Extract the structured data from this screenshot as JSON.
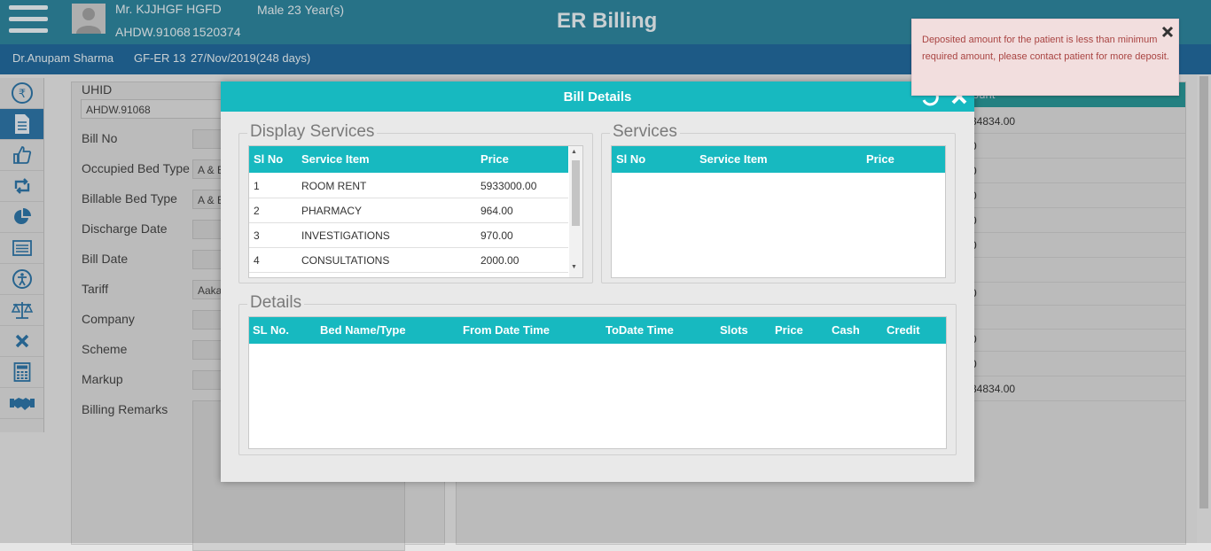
{
  "patient": {
    "name": "Mr. KJJHGF HGFD",
    "gender_age": "Male 23 Year(s)",
    "uhid": "AHDW.91068",
    "id": "1520374"
  },
  "app_title": "ER Billing",
  "subbar": {
    "doctor": "Dr.Anupam Sharma",
    "ward": "GF-ER 13",
    "admission": "27/Nov/2019(248 days)"
  },
  "sidebar": {
    "items": [
      "rupee-icon",
      "document-icon",
      "thumbs-up-icon",
      "retweet-icon",
      "pie-chart-icon",
      "list-icon",
      "accessibility-icon",
      "scale-icon",
      "close-icon",
      "calculator-icon",
      "handshake-icon"
    ]
  },
  "form": {
    "uhid_label": "UHID",
    "uhid_value": "AHDW.91068",
    "bill_no": "Bill No",
    "occupied_bed_type": "Occupied Bed Type",
    "occupied_bed_value": "A & E",
    "billable_bed_type": "Billable Bed Type",
    "billable_bed_value": "A & E",
    "discharge_date": "Discharge Date",
    "bill_date": "Bill Date",
    "tariff": "Tariff",
    "tariff_value": "Aaka",
    "company": "Company",
    "scheme": "Scheme",
    "markup": "Markup",
    "billing_remarks": "Billing Remarks"
  },
  "right_panel": {
    "head_partial": "ount",
    "rows": [
      "34834.00",
      "0",
      "0",
      "0",
      "0",
      "0",
      "",
      "0",
      "",
      "0",
      "0",
      "34834.00"
    ]
  },
  "modal": {
    "title": "Bill Details",
    "display_services": {
      "legend": "Display Services",
      "headers": [
        "Sl No",
        "Service Item",
        "Price"
      ],
      "rows": [
        {
          "sl": "1",
          "item": "ROOM RENT",
          "price": "5933000.00"
        },
        {
          "sl": "2",
          "item": "PHARMACY",
          "price": "964.00"
        },
        {
          "sl": "3",
          "item": "INVESTIGATIONS",
          "price": "970.00"
        },
        {
          "sl": "4",
          "item": "CONSULTATIONS",
          "price": "2000.00"
        }
      ]
    },
    "services": {
      "legend": "Services",
      "headers": [
        "Sl No",
        "Service Item",
        "Price"
      ]
    },
    "details": {
      "legend": "Details",
      "headers": [
        "SL No.",
        "Bed Name/Type",
        "From Date Time",
        "ToDate Time",
        "Slots",
        "Price",
        "Cash",
        "Credit"
      ]
    }
  },
  "toast": {
    "message": "Deposited amount for the patient is less than minimum required amount, please contact patient for more deposit."
  },
  "colors": {
    "header": "#1b7b96",
    "subbar": "#0f5d95",
    "accent": "#17b9c0",
    "toast_bg": "#f2dede",
    "toast_text": "#a94442"
  }
}
